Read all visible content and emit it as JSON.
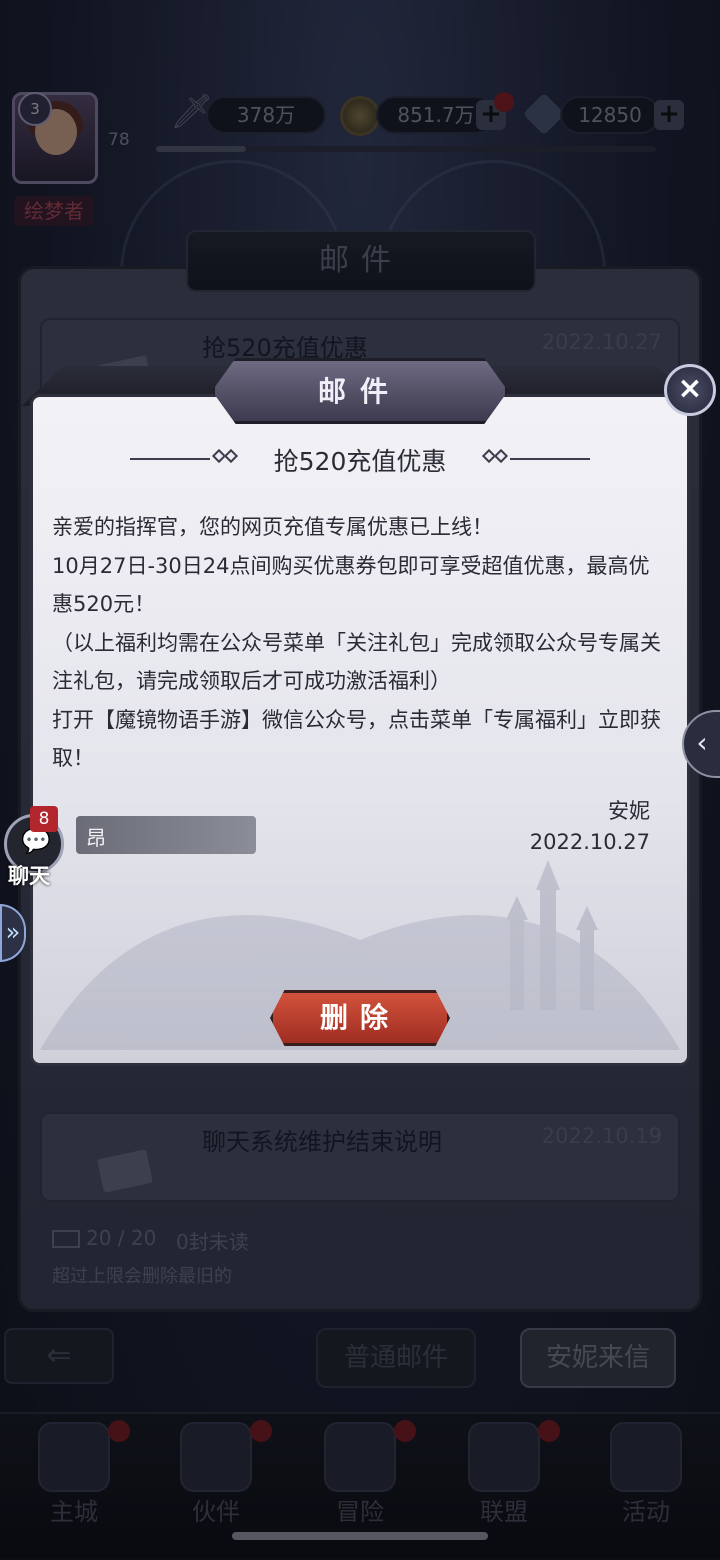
{
  "hud": {
    "avatar_level": "3",
    "vip_level": "78",
    "player_title": "绘梦者",
    "power": "378万",
    "gold": "851.7万",
    "diamonds": "12850",
    "plus": "+"
  },
  "mail_window": {
    "title": "邮件",
    "rows": [
      {
        "title": "抢520充值优惠",
        "date": "2022.10.27"
      },
      {
        "title": "聊天系统维护结束说明",
        "date": "2022.10.19"
      }
    ],
    "capacity": "20 / 20",
    "unread": "0封未读",
    "limit_note": "超过上限会删除最旧的",
    "tabs": {
      "normal": "普通邮件",
      "annie": "安妮来信"
    }
  },
  "modal": {
    "header": "邮件",
    "close_icon": "×",
    "subject": "抢520充值优惠",
    "body": [
      "亲爱的指挥官，您的网页充值专属优惠已上线！",
      "10月27日-30日24点间购买优惠券包即可享受超值优惠，最高优惠520元！",
      "（以上福利均需在公众号菜单「关注礼包」完成领取公众号专属关注礼包，请完成领取后才可成功激活福利）",
      "打开【魔镜物语手游】微信公众号，点击菜单「专属福利」立即获取！"
    ],
    "sender": "安妮",
    "date": "2022.10.27",
    "delete_label": "删除"
  },
  "chat": {
    "badge": "8",
    "label": "聊天",
    "ticker": "昂"
  },
  "nav": [
    {
      "label": "主城",
      "icon": "castle-icon",
      "dot": true
    },
    {
      "label": "伙伴",
      "icon": "witch-hat-icon",
      "dot": true
    },
    {
      "label": "冒险",
      "icon": "compass-icon",
      "dot": true
    },
    {
      "label": "联盟",
      "icon": "shield-icon",
      "dot": true
    },
    {
      "label": "活动",
      "icon": "cards-icon",
      "dot": false
    }
  ],
  "colors": {
    "delete_button": "#c0442f",
    "badge_red": "#b3262b",
    "modal_bg": "#ececf2"
  },
  "progress": {
    "xp_fraction": 0.18
  }
}
